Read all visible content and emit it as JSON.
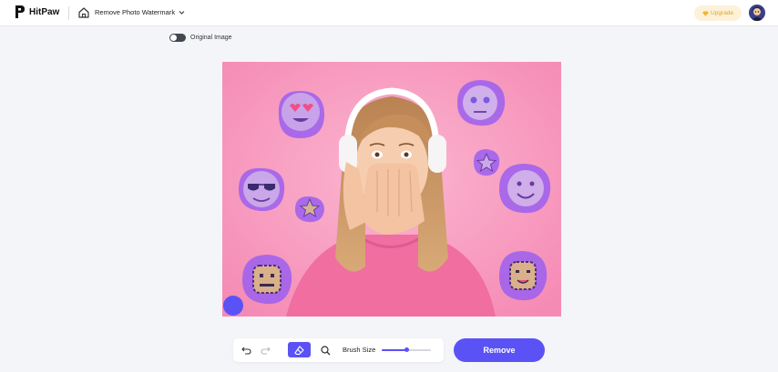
{
  "header": {
    "app_name": "HitPaw",
    "tool_title": "Remove Photo Watermark",
    "upgrade_label": "Upgrade",
    "icons": {
      "logo": "hitpaw-logo-icon",
      "home": "home-icon",
      "dropdown": "chevron-down-icon",
      "upgrade": "diamond-icon"
    }
  },
  "view": {
    "toggle_label": "Original Image",
    "toggle_on": false
  },
  "toolbar": {
    "undo_icon": "undo-icon",
    "redo_icon": "redo-icon",
    "eraser_icon": "eraser-icon",
    "zoom_icon": "magnifier-icon",
    "brush_size_label": "Brush Size",
    "brush_size_fraction": 0.5
  },
  "actions": {
    "remove_label": "Remove"
  },
  "colors": {
    "accent": "#5b52f5",
    "upgrade_bg": "#fdf1d9",
    "upgrade_text": "#e4a31a",
    "canvas_bg": "#f79bc0",
    "mask": "#9b5ff0"
  }
}
